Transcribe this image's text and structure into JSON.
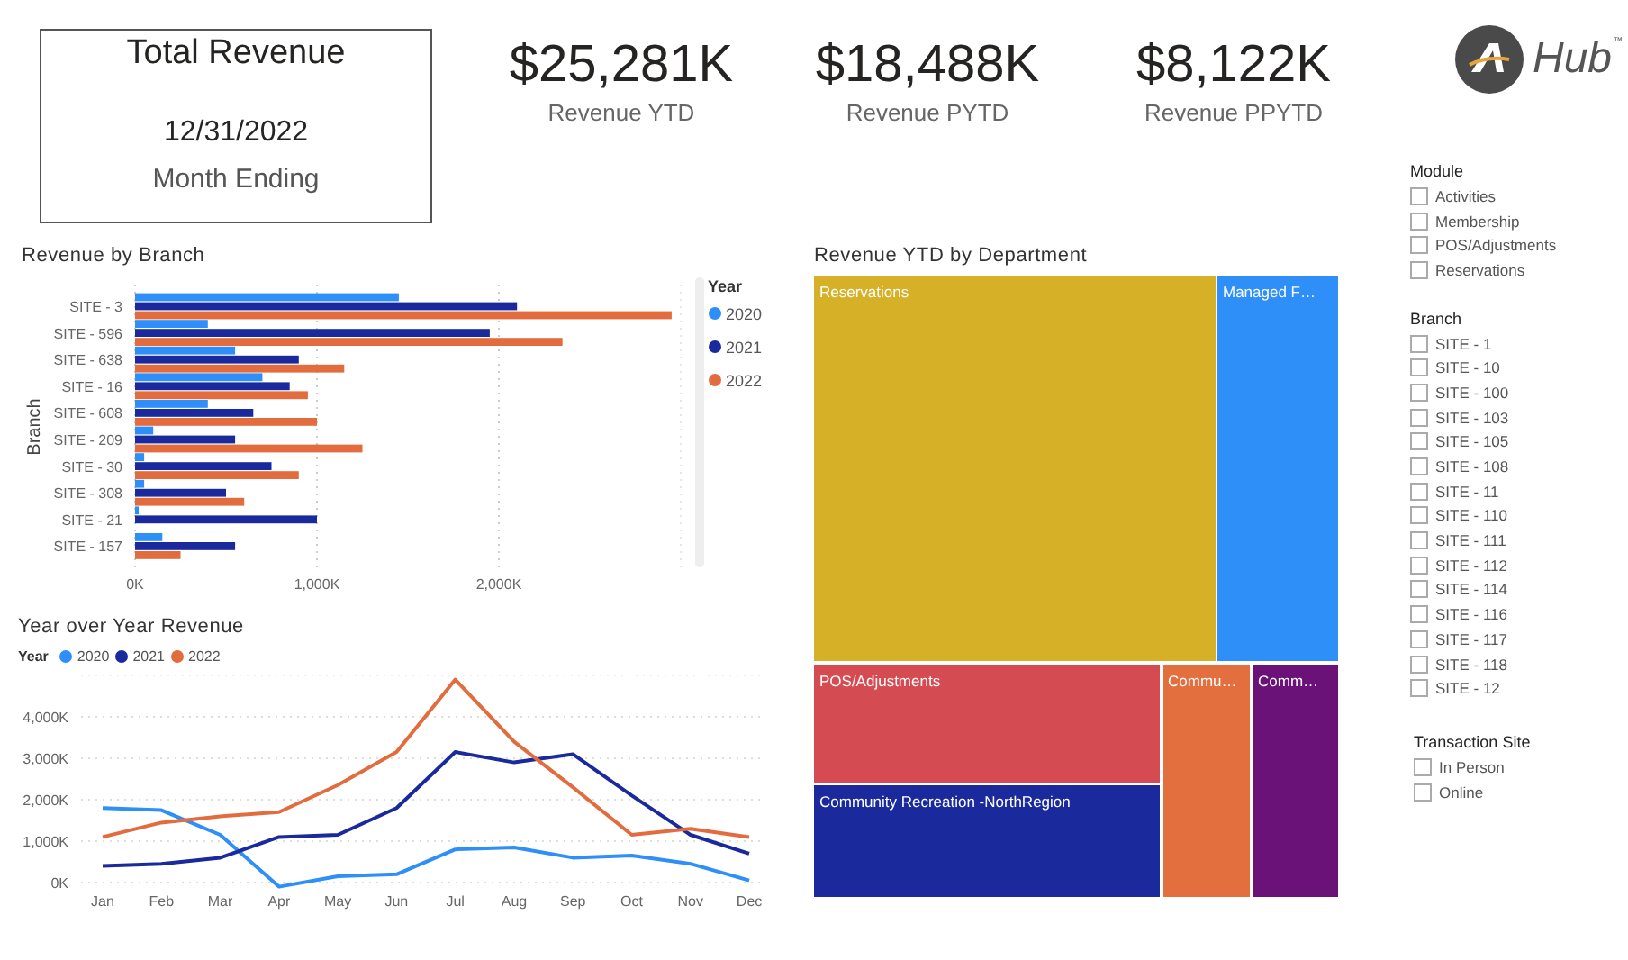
{
  "kpi_card": {
    "title": "Total Revenue",
    "date": "12/31/2022",
    "caption": "Month Ending"
  },
  "kpis": [
    {
      "value": "$25,281K",
      "label": "Revenue YTD"
    },
    {
      "value": "$18,488K",
      "label": "Revenue PYTD"
    },
    {
      "value": "$8,122K",
      "label": "Revenue PPYTD"
    }
  ],
  "logo": {
    "text": "Hub",
    "mark": "™"
  },
  "bar_chart": {
    "legend_title": "Year",
    "chart_data": {
      "type": "bar",
      "orientation": "horizontal",
      "title": "Revenue by Branch",
      "ylabel": "Branch",
      "categories": [
        "SITE - 3",
        "SITE - 596",
        "SITE - 638",
        "SITE - 16",
        "SITE - 608",
        "SITE - 209",
        "SITE - 30",
        "SITE - 308",
        "SITE - 21",
        "SITE - 157"
      ],
      "series": [
        {
          "name": "2020",
          "color": "#2d8ff7",
          "values": [
            1450,
            400,
            550,
            700,
            400,
            100,
            50,
            50,
            20,
            150
          ]
        },
        {
          "name": "2021",
          "color": "#1a2a9c",
          "values": [
            2100,
            1950,
            900,
            850,
            650,
            550,
            750,
            500,
            1000,
            550
          ]
        },
        {
          "name": "2022",
          "color": "#e36c3f",
          "values": [
            2950,
            2350,
            1150,
            950,
            1000,
            1250,
            900,
            600,
            null,
            250
          ]
        }
      ],
      "grid": true,
      "legend": true,
      "xlim": [
        0,
        3000
      ],
      "xticks": [
        {
          "value": 0,
          "label": "0K"
        },
        {
          "value": 1000,
          "label": "1,000K"
        },
        {
          "value": 2000,
          "label": "2,000K"
        }
      ]
    }
  },
  "line_chart": {
    "legend_title": "Year",
    "chart_data": {
      "type": "line",
      "title": "Year over Year Revenue",
      "x": [
        "Jan",
        "Feb",
        "Mar",
        "Apr",
        "May",
        "Jun",
        "Jul",
        "Aug",
        "Sep",
        "Oct",
        "Nov",
        "Dec"
      ],
      "series": [
        {
          "name": "2020",
          "color": "#2d8ff7",
          "values": [
            1800,
            1750,
            1150,
            -100,
            150,
            200,
            800,
            850,
            600,
            650,
            450,
            50
          ]
        },
        {
          "name": "2021",
          "color": "#1a2a9c",
          "values": [
            400,
            450,
            600,
            1100,
            1150,
            1800,
            3150,
            2900,
            3100,
            2100,
            1150,
            700
          ]
        },
        {
          "name": "2022",
          "color": "#e36c3f",
          "values": [
            1100,
            1450,
            1600,
            1700,
            2350,
            3150,
            4900,
            3400,
            2300,
            1150,
            1300,
            1100
          ]
        }
      ],
      "grid": true,
      "legend": true,
      "ylim": [
        -100,
        5000
      ],
      "yticks": [
        {
          "value": 0,
          "label": "0K"
        },
        {
          "value": 1000,
          "label": "1,000K"
        },
        {
          "value": 2000,
          "label": "2,000K"
        },
        {
          "value": 3000,
          "label": "3,000K"
        },
        {
          "value": 4000,
          "label": "4,000K"
        }
      ]
    }
  },
  "treemap": {
    "title": "Revenue YTD by Department",
    "tiles": [
      {
        "label": "Reservations",
        "color": "#d6b027"
      },
      {
        "label": "Managed F…",
        "color": "#2d8ff7"
      },
      {
        "label": "POS/Adjustments",
        "color": "#d44b52"
      },
      {
        "label": "Commu…",
        "color": "#e36f3f"
      },
      {
        "label": "Comm…",
        "color": "#6a1277"
      },
      {
        "label": "Community Recreation -NorthRegion",
        "color": "#1a2a9c"
      }
    ]
  },
  "slicers": [
    {
      "title": "Module",
      "items": [
        {
          "label": "Activities",
          "checked": false
        },
        {
          "label": "Membership",
          "checked": false
        },
        {
          "label": "POS/Adjustments",
          "checked": false
        },
        {
          "label": "Reservations",
          "checked": false
        }
      ]
    },
    {
      "title": "Branch",
      "items": [
        {
          "label": "SITE - 1",
          "checked": false
        },
        {
          "label": "SITE - 10",
          "checked": false
        },
        {
          "label": "SITE - 100",
          "checked": false
        },
        {
          "label": "SITE - 103",
          "checked": false
        },
        {
          "label": "SITE - 105",
          "checked": false
        },
        {
          "label": "SITE - 108",
          "checked": false
        },
        {
          "label": "SITE - 11",
          "checked": false
        },
        {
          "label": "SITE - 110",
          "checked": false
        },
        {
          "label": "SITE - 111",
          "checked": false
        },
        {
          "label": "SITE - 112",
          "checked": false
        },
        {
          "label": "SITE - 114",
          "checked": false
        },
        {
          "label": "SITE - 116",
          "checked": false
        },
        {
          "label": "SITE - 117",
          "checked": false
        },
        {
          "label": "SITE - 118",
          "checked": false
        },
        {
          "label": "SITE - 12",
          "checked": false
        }
      ]
    },
    {
      "title": "Transaction Site",
      "items": [
        {
          "label": "In Person",
          "checked": false
        },
        {
          "label": "Online",
          "checked": false
        }
      ]
    }
  ]
}
